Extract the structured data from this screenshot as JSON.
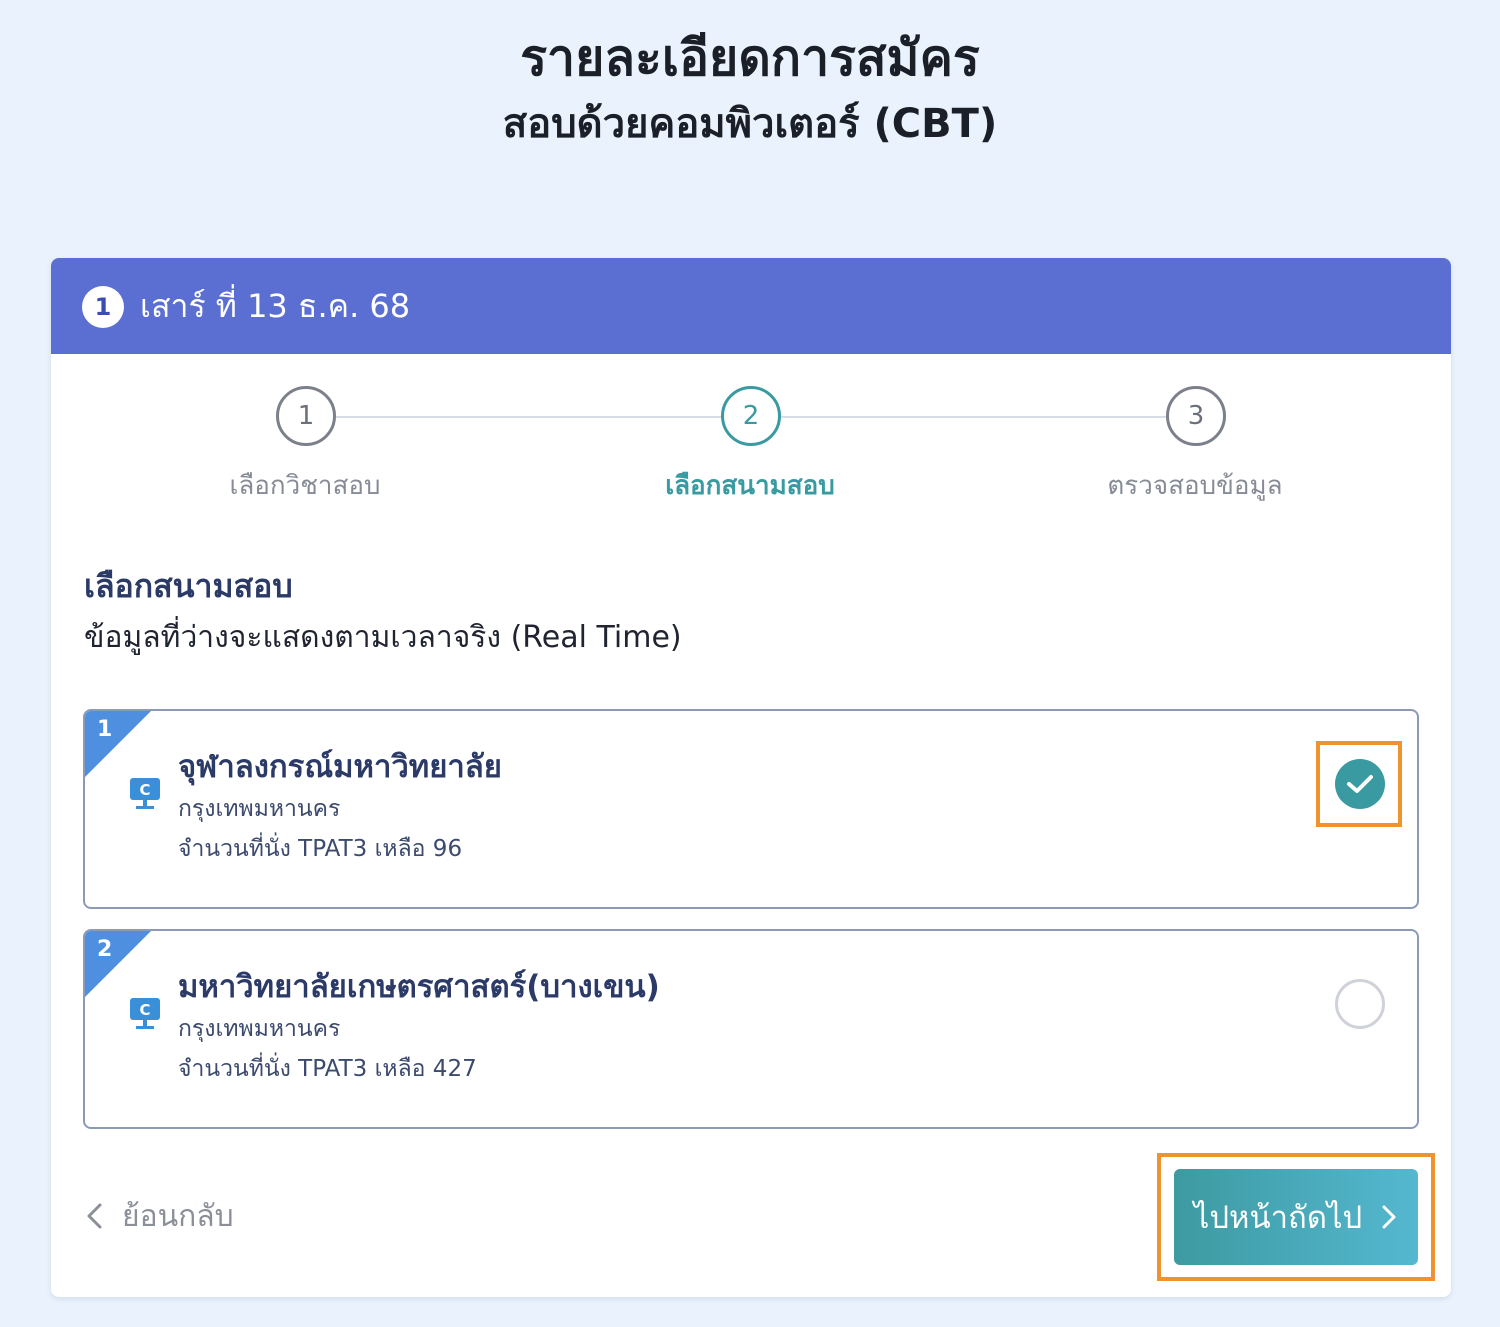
{
  "page": {
    "title": "รายละเอียดการสมัคร",
    "subtitle": "สอบด้วยคอมพิวเตอร์ (CBT)"
  },
  "session": {
    "number": "1",
    "date": "เสาร์ ที่ 13 ธ.ค. 68"
  },
  "steps": [
    {
      "number": "1",
      "label": "เลือกวิชาสอบ",
      "active": false
    },
    {
      "number": "2",
      "label": "เลือกสนามสอบ",
      "active": true
    },
    {
      "number": "3",
      "label": "ตรวจสอบข้อมูล",
      "active": false
    }
  ],
  "section": {
    "title": "เลือกสนามสอบ",
    "description": "ข้อมูลที่ว่างจะแสดงตามเวลาจริง (Real Time)"
  },
  "venues": [
    {
      "index": "1",
      "icon": "computer-c-icon",
      "icon_letter": "C",
      "name": "จุฬาลงกรณ์มหาวิทยาลัย",
      "province": "กรุงเทพมหานคร",
      "seats": "จำนวนที่นั่ง TPAT3 เหลือ 96",
      "selected": true
    },
    {
      "index": "2",
      "icon": "computer-c-icon",
      "icon_letter": "C",
      "name": "มหาวิทยาลัยเกษตรศาสตร์(บางเขน)",
      "province": "กรุงเทพมหานคร",
      "seats": "จำนวนที่นั่ง TPAT3 เหลือ 427",
      "selected": false
    }
  ],
  "nav": {
    "back_label": "ย้อนกลับ",
    "next_label": "ไปหน้าถัดไป"
  },
  "colors": {
    "header": "#5b6fd2",
    "accent": "#3a9aa2",
    "highlight": "#f0922e",
    "background": "#eaf3fd"
  }
}
